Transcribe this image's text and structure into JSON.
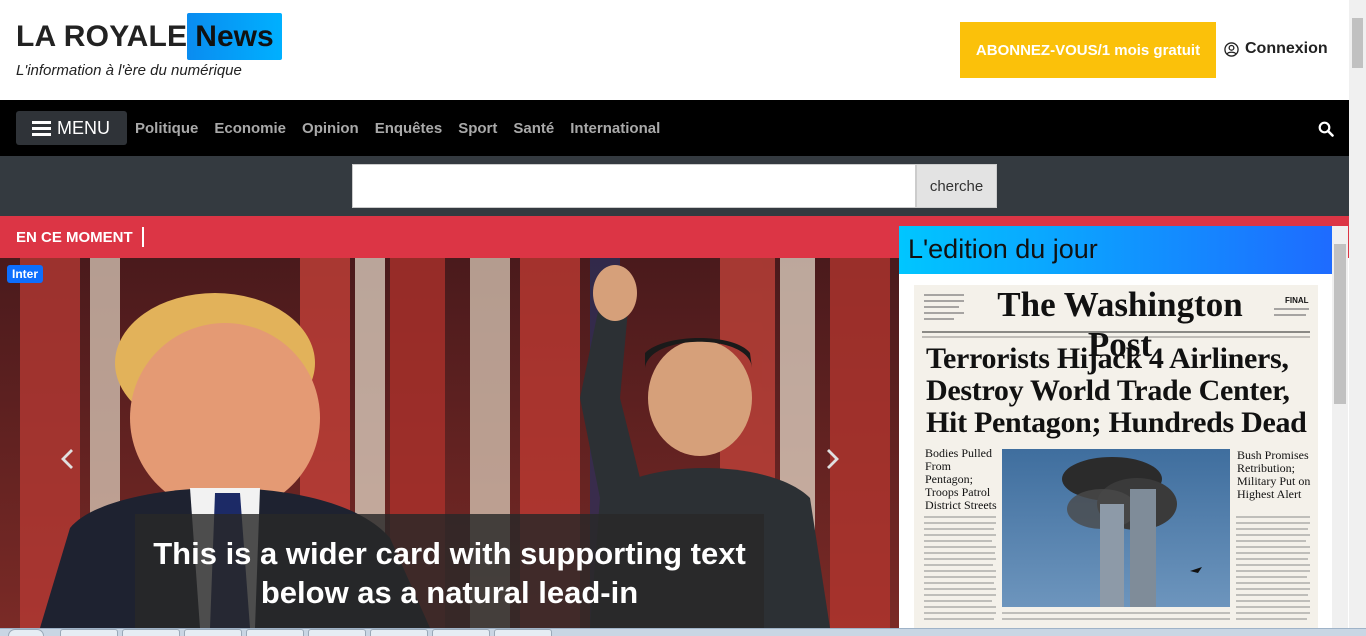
{
  "header": {
    "logo_main": "LA ROYALE",
    "logo_news": "News",
    "tagline": "L'information à l'ère du numérique",
    "subscribe_label": "ABONNEZ-VOUS/1 mois gratuit",
    "login_label": "Connexion",
    "login_icon": "user-circle-icon"
  },
  "nav": {
    "menu_label": "MENU",
    "links": [
      "Politique",
      "Economie",
      "Opinion",
      "Enquêtes",
      "Sport",
      "Santé",
      "International"
    ],
    "search_icon": "search-icon"
  },
  "search": {
    "value": "",
    "button_label": "cherche"
  },
  "ticker": {
    "label": "EN CE MOMENT"
  },
  "carousel": {
    "badge": "Inter",
    "caption": "This is a wider card with supporting text below as a natural lead-in",
    "prev_icon": "chevron-left-icon",
    "next_icon": "chevron-right-icon"
  },
  "edition": {
    "title": "L'edition du jour",
    "paper_name": "The Washington Post",
    "paper_final": "FINAL",
    "headline": "Terrorists Hijack 4 Airliners, Destroy World Trade Center, Hit Pentagon; Hundreds Dead",
    "left_sub": "Bodies Pulled From Pentagon; Troops Patrol District Streets",
    "right_sub": "Bush Promises Retribution; Military Put on Highest Alert"
  },
  "colors": {
    "accent_red": "#dc3545",
    "subscribe_yellow": "#fbc10a",
    "nav_black": "#000000",
    "search_strip": "#343a40",
    "news_blue": "#0a8cf0"
  }
}
